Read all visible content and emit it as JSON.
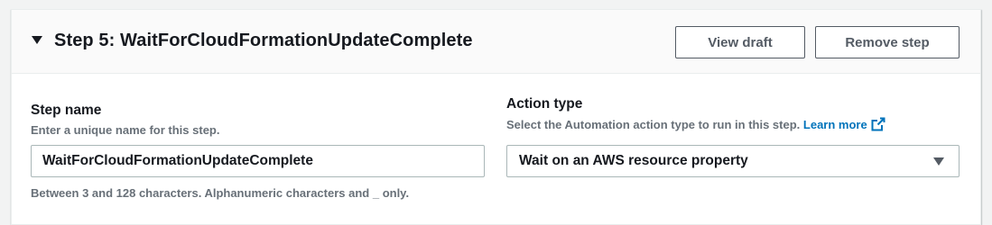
{
  "step": {
    "title": "Step 5: WaitForCloudFormationUpdateComplete",
    "view_draft_label": "View draft",
    "remove_step_label": "Remove step"
  },
  "step_name": {
    "label": "Step name",
    "description": "Enter a unique name for this step.",
    "value": "WaitForCloudFormationUpdateComplete",
    "constraint": "Between 3 and 128 characters. Alphanumeric characters and _ only."
  },
  "action_type": {
    "label": "Action type",
    "description": "Select the Automation action type to run in this step.",
    "learn_more": "Learn more",
    "selected": "Wait on an AWS resource property"
  },
  "icons": {
    "collapse": "caret-down-icon",
    "external_link": "external-link-icon",
    "dropdown": "caret-down-icon"
  },
  "colors": {
    "link": "#0073bb",
    "secondary_text": "#687078",
    "border": "#aab7b8"
  }
}
